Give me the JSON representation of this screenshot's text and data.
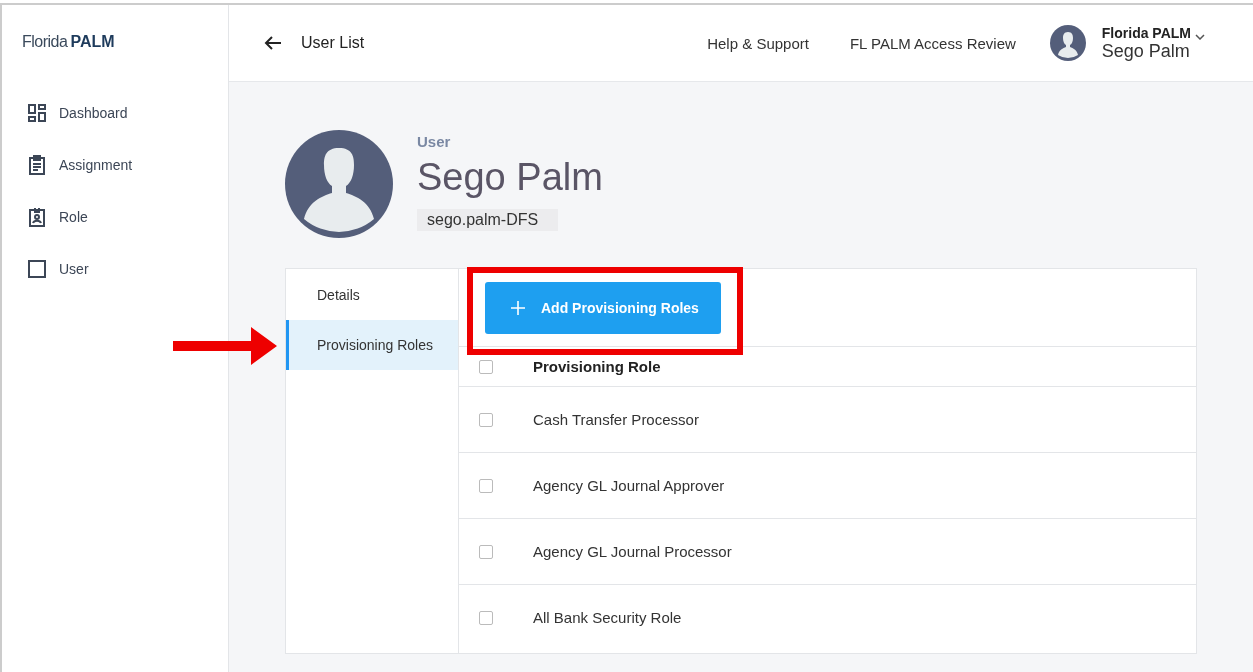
{
  "logo": {
    "name": "Florida",
    "brand": "PALM"
  },
  "sidebar": {
    "items": [
      {
        "label": "Dashboard",
        "kind": "dashboard"
      },
      {
        "label": "Assignment",
        "kind": "clipboard"
      },
      {
        "label": "Role",
        "kind": "badge"
      },
      {
        "label": "User",
        "kind": "square"
      }
    ]
  },
  "header": {
    "back_label": "User List",
    "links": [
      "Help & Support",
      "FL PALM Access Review"
    ],
    "account": {
      "org": "Florida PALM",
      "name": "Sego Palm"
    }
  },
  "profile": {
    "caption": "User",
    "name": "Sego Palm",
    "username": "sego.palm-DFS"
  },
  "tabs": [
    {
      "label": "Details",
      "selected": false
    },
    {
      "label": "Provisioning Roles",
      "selected": true
    }
  ],
  "add_button": "Add Provisioning Roles",
  "table": {
    "column": "Provisioning Role",
    "header_checked": false,
    "rows": [
      {
        "name": "Cash Transfer Processor",
        "checked": false
      },
      {
        "name": "Agency GL Journal Approver",
        "checked": false
      },
      {
        "name": "Agency GL Journal Processor",
        "checked": false
      },
      {
        "name": "All Bank Security Role",
        "checked": false
      }
    ]
  }
}
